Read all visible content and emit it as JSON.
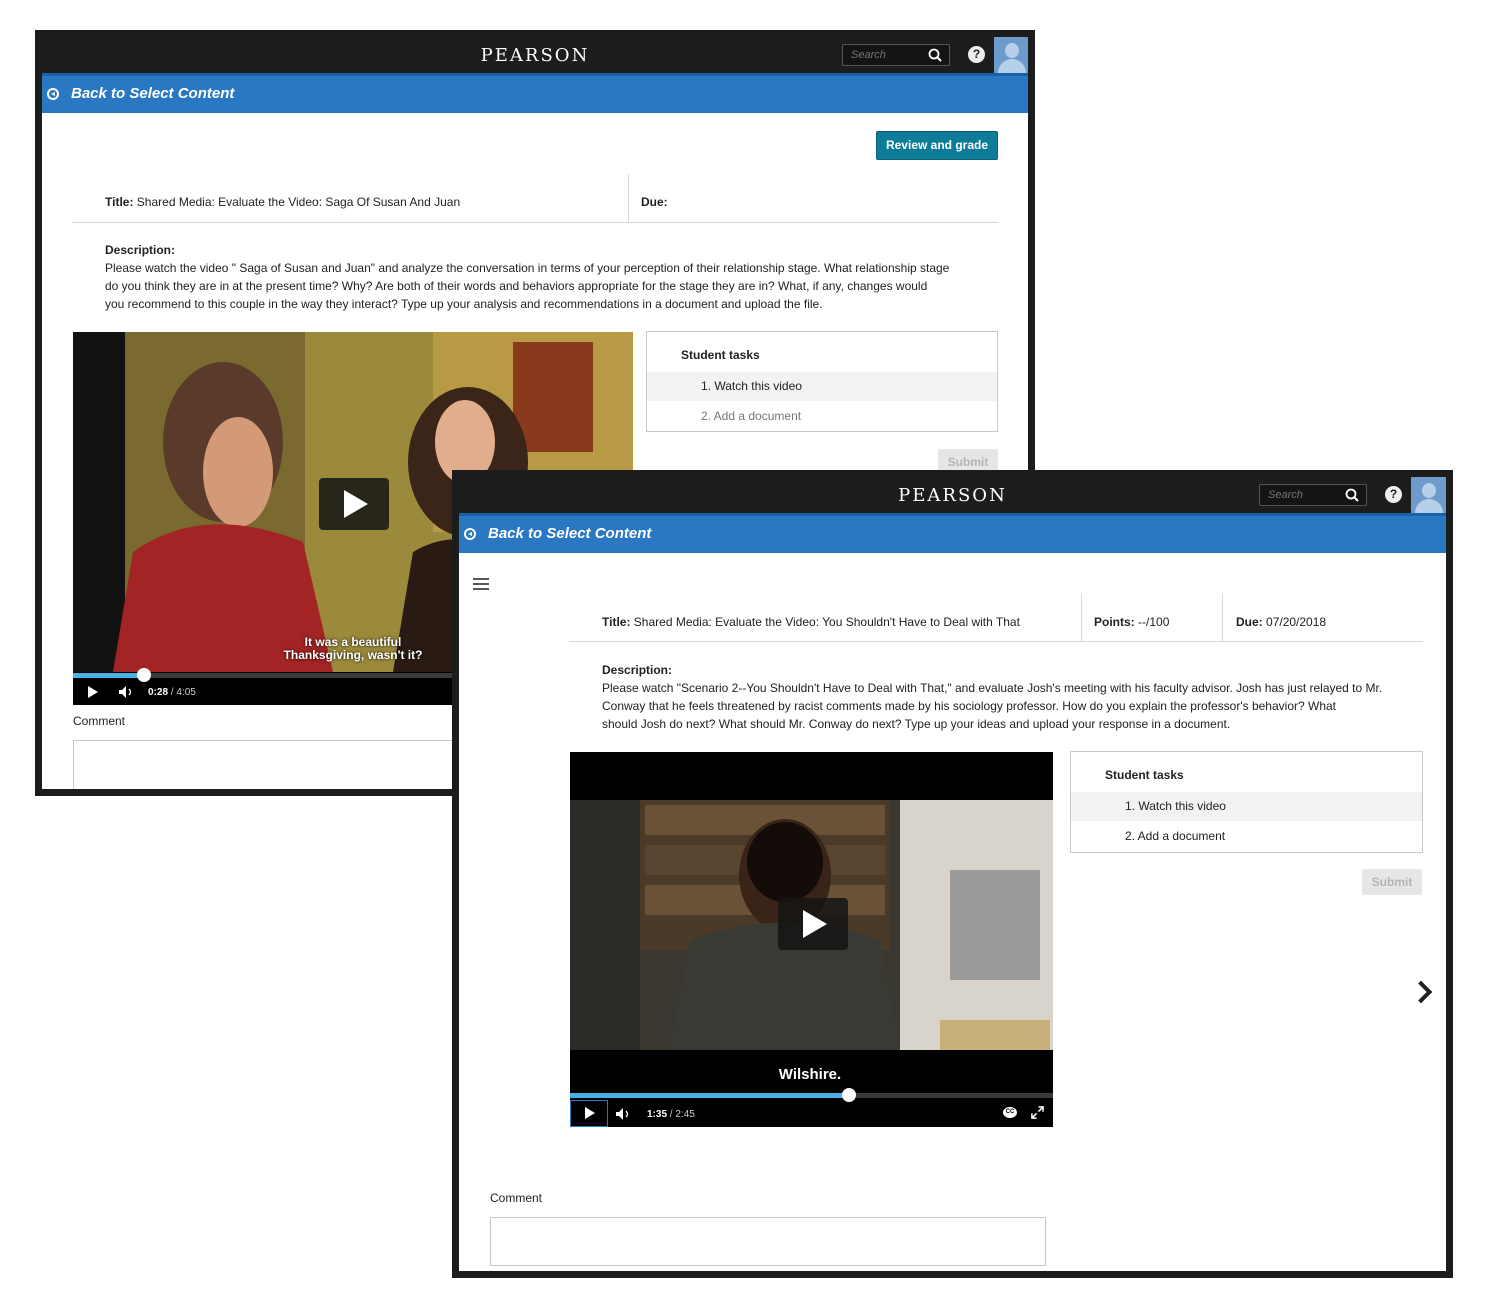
{
  "colors": {
    "brand_bar": "#1d1d1d",
    "accent_blue": "#2a78c2",
    "review_button": "#0c7c99",
    "progress": "#4ab0e3"
  },
  "back_screen": {
    "header": {
      "brand": "PEARSON",
      "search_placeholder": "Search",
      "help_glyph": "?"
    },
    "back_link": {
      "prefix": "Back to ",
      "target": "Select Content"
    },
    "review_button": "Review and grade",
    "title_label": "Title:",
    "title_value": "Shared Media: Evaluate the Video: Saga Of Susan And Juan",
    "due_label": "Due:",
    "description_label": "Description:",
    "description_lines": [
      "Please watch the video \" Saga of Susan and Juan\" and analyze the conversation in terms of your perception of their relationship stage. What relationship stage",
      "do you think they are in at the present time? Why? Are both of their words and behaviors appropriate for the stage they are in? What, if any, changes would",
      "you recommend to this couple in the way they interact? Type up your analysis and recommendations in a document and upload the file."
    ],
    "student_tasks": {
      "heading": "Student tasks",
      "items": [
        "1. Watch this video",
        "2. Add a document"
      ]
    },
    "submit_label": "Submit",
    "video": {
      "caption_line1": "It was a beautiful",
      "caption_line2": "Thanksgiving, wasn't it?",
      "current_time": "0:28",
      "duration": "/ 4:05",
      "progress": 0.12
    },
    "comment_label": "Comment"
  },
  "front_screen": {
    "header": {
      "brand": "PEARSON",
      "search_placeholder": "Search",
      "help_glyph": "?"
    },
    "back_link": {
      "prefix": "Back to ",
      "target": "Select Content"
    },
    "title_label": "Title:",
    "title_value": "Shared Media: Evaluate the Video: You Shouldn't Have to Deal with That",
    "points_label": "Points:",
    "points_value": "--/100",
    "due_label": "Due:",
    "due_value": "07/20/2018",
    "description_label": "Description:",
    "description_lines": [
      "Please watch \"Scenario 2--You Shouldn't Have to Deal with That,\" and evaluate Josh's meeting with his faculty advisor. Josh has just relayed to Mr.",
      "Conway that he feels threatened by racist comments made by his sociology professor. How do you explain the professor's behavior? What",
      "should Josh do next? What should Mr. Conway do next? Type up your ideas and upload your response in a document."
    ],
    "student_tasks": {
      "heading": "Student tasks",
      "items": [
        "1. Watch this video",
        "2. Add a document"
      ]
    },
    "submit_label": "Submit",
    "video": {
      "caption": "Wilshire.",
      "current_time": "1:35",
      "duration": "/ 2:45",
      "progress": 0.58,
      "cc": "CC"
    },
    "comment_label": "Comment"
  }
}
